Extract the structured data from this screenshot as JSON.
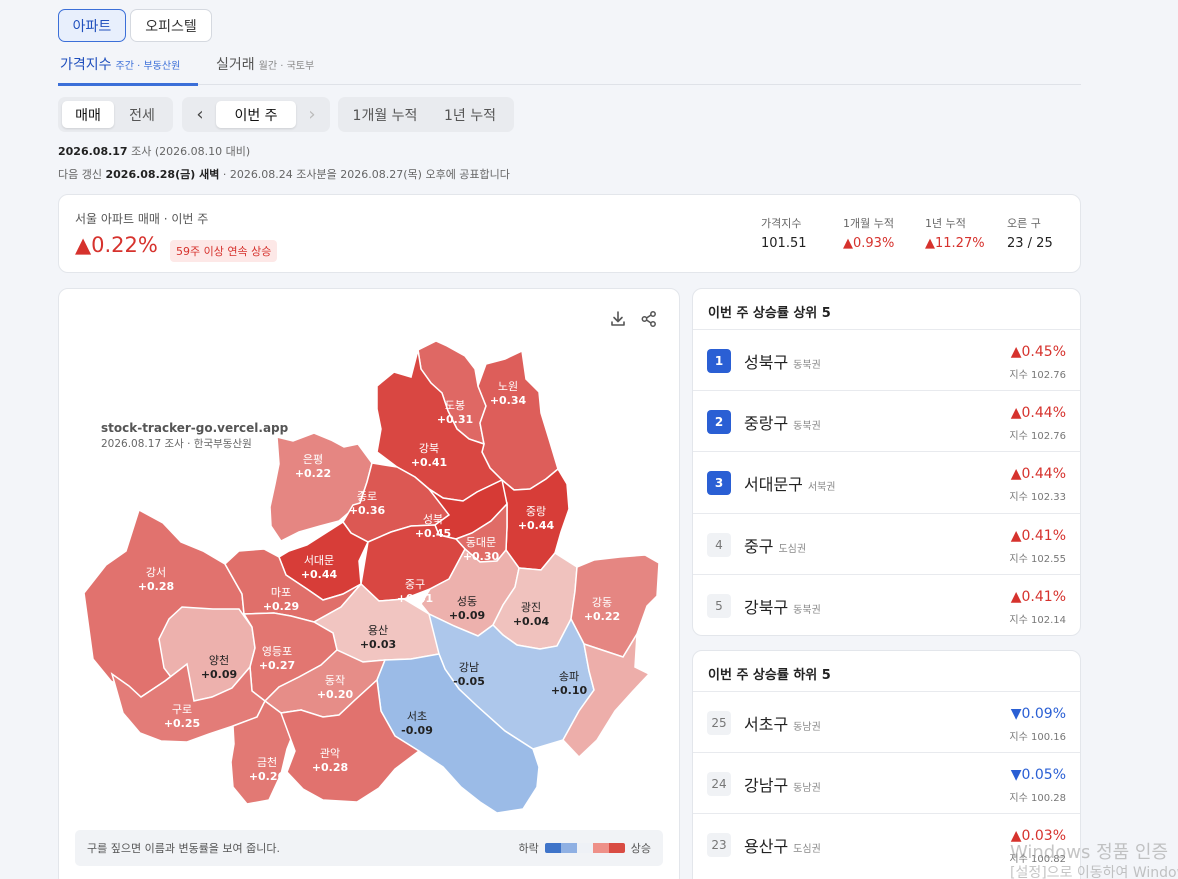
{
  "property_tabs": [
    "아파트",
    "오피스텔"
  ],
  "main_tabs": [
    {
      "label": "가격지수",
      "sub": "주간 · 부동산원"
    },
    {
      "label": "실거래",
      "sub": "월간 · 국토부"
    }
  ],
  "trade_type": {
    "options": [
      "매매",
      "전세"
    ],
    "selected": "매매"
  },
  "period": {
    "prev": "‹",
    "current": "이번 주",
    "next": "›"
  },
  "cumulative": [
    "1개월 누적",
    "1년 누적"
  ],
  "survey": {
    "date": "2026.08.17",
    "label": " 조사 (2026.08.10 대비)"
  },
  "next_update": {
    "prefix": "다음 갱신 ",
    "date": "2026.08.28(금) 새벽",
    "suffix": " · 2026.08.24 조사분을 2026.08.27(목) 오후에 공표합니다"
  },
  "summary": {
    "title": "서울 아파트 매매 · 이번 주",
    "change": "▲0.22%",
    "badge": "59주 이상 연속 상승",
    "stats": [
      {
        "label": "가격지수",
        "value": "101.51",
        "up": false
      },
      {
        "label": "1개월 누적",
        "value": "▲0.93%",
        "up": true
      },
      {
        "label": "1년 누적",
        "value": "▲11.27%",
        "up": true
      },
      {
        "label": "오른 구",
        "value": "23 / 25",
        "up": false
      }
    ]
  },
  "map": {
    "watermark_site": "stock-tracker-go.vercel.app",
    "watermark_date": "2026.08.17 조사 · 한국부동산원",
    "download_icon": "download-icon",
    "share_icon": "share-icon",
    "hint": "구를 짚으면 이름과 변동률을 보여 줍니다.",
    "legend_low": "하락",
    "legend_high": "상승",
    "legend_colors": [
      "#3f74c9",
      "#8fb0e3",
      "#eef1f6",
      "#ee9088",
      "#d94c43"
    ],
    "districts": [
      {
        "name": "도봉",
        "value": "+0.31",
        "change": 0.31
      },
      {
        "name": "노원",
        "value": "+0.34",
        "change": 0.34
      },
      {
        "name": "강북",
        "value": "+0.41",
        "change": 0.41
      },
      {
        "name": "은평",
        "value": "+0.22",
        "change": 0.22
      },
      {
        "name": "종로",
        "value": "+0.36",
        "change": 0.36
      },
      {
        "name": "성북",
        "value": "+0.45",
        "change": 0.45
      },
      {
        "name": "중랑",
        "value": "+0.44",
        "change": 0.44
      },
      {
        "name": "동대문",
        "value": "+0.30",
        "change": 0.3
      },
      {
        "name": "서대문",
        "value": "+0.44",
        "change": 0.44
      },
      {
        "name": "강서",
        "value": "+0.28",
        "change": 0.28
      },
      {
        "name": "마포",
        "value": "+0.29",
        "change": 0.29
      },
      {
        "name": "중구",
        "value": "+0.41",
        "change": 0.41
      },
      {
        "name": "성동",
        "value": "+0.09",
        "change": 0.09
      },
      {
        "name": "광진",
        "value": "+0.04",
        "change": 0.04
      },
      {
        "name": "강동",
        "value": "+0.22",
        "change": 0.22
      },
      {
        "name": "용산",
        "value": "+0.03",
        "change": 0.03
      },
      {
        "name": "양천",
        "value": "+0.09",
        "change": 0.09
      },
      {
        "name": "영등포",
        "value": "+0.27",
        "change": 0.27
      },
      {
        "name": "강남",
        "value": "-0.05",
        "change": -0.05
      },
      {
        "name": "송파",
        "value": "+0.10",
        "change": 0.1
      },
      {
        "name": "동작",
        "value": "+0.20",
        "change": 0.2
      },
      {
        "name": "구로",
        "value": "+0.25",
        "change": 0.25
      },
      {
        "name": "서초",
        "value": "-0.09",
        "change": -0.09
      },
      {
        "name": "금천",
        "value": "+0.26",
        "change": 0.26
      },
      {
        "name": "관악",
        "value": "+0.28",
        "change": 0.28
      }
    ]
  },
  "top5": {
    "title": "이번 주 상승률 상위 5",
    "items": [
      {
        "rank": "1",
        "name": "성북구",
        "zone": "동북권",
        "pct": "▲0.45%",
        "index": "지수 102.76",
        "hi": true
      },
      {
        "rank": "2",
        "name": "중랑구",
        "zone": "동북권",
        "pct": "▲0.44%",
        "index": "지수 102.76",
        "hi": true
      },
      {
        "rank": "3",
        "name": "서대문구",
        "zone": "서북권",
        "pct": "▲0.44%",
        "index": "지수 102.33",
        "hi": true
      },
      {
        "rank": "4",
        "name": "중구",
        "zone": "도심권",
        "pct": "▲0.41%",
        "index": "지수 102.55",
        "hi": false
      },
      {
        "rank": "5",
        "name": "강북구",
        "zone": "동북권",
        "pct": "▲0.41%",
        "index": "지수 102.14",
        "hi": false
      }
    ]
  },
  "bottom5": {
    "title": "이번 주 상승률 하위 5",
    "items": [
      {
        "rank": "25",
        "name": "서초구",
        "zone": "동남권",
        "pct": "▼0.09%",
        "index": "지수 100.16",
        "up": false
      },
      {
        "rank": "24",
        "name": "강남구",
        "zone": "동남권",
        "pct": "▼0.05%",
        "index": "지수 100.28",
        "up": false
      },
      {
        "rank": "23",
        "name": "용산구",
        "zone": "도심권",
        "pct": "▲0.03%",
        "index": "지수 100.82",
        "up": true
      }
    ]
  },
  "os_watermark": {
    "line1": "Windows 정품 인증",
    "line2": "[설정]으로 이동하여 Windows"
  }
}
